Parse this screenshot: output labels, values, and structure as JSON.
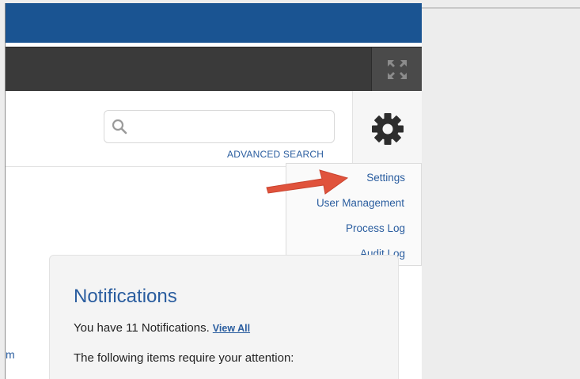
{
  "header": {
    "search": {
      "value": "",
      "placeholder": ""
    },
    "advanced_search_label": "ADVANCED SEARCH"
  },
  "icons": {
    "fullscreen": "fullscreen-icon",
    "search": "search-icon",
    "settings": "gear-icon",
    "arrow": "arrow-icon"
  },
  "settings_menu": {
    "items": [
      {
        "label": "Settings"
      },
      {
        "label": "User Management"
      },
      {
        "label": "Process Log"
      },
      {
        "label": "Audit Log"
      }
    ]
  },
  "notifications": {
    "title": "Notifications",
    "count_text": "You have 11 Notifications.",
    "view_all_label": "View All",
    "attention_text": "The following items require your attention:"
  },
  "sidebar_fragment": {
    "text": "m"
  },
  "colors": {
    "brand_blue": "#1a5492",
    "link_blue": "#2a5d9f",
    "dark_bar": "#3a3a3a",
    "arrow_red": "#e0533c"
  }
}
